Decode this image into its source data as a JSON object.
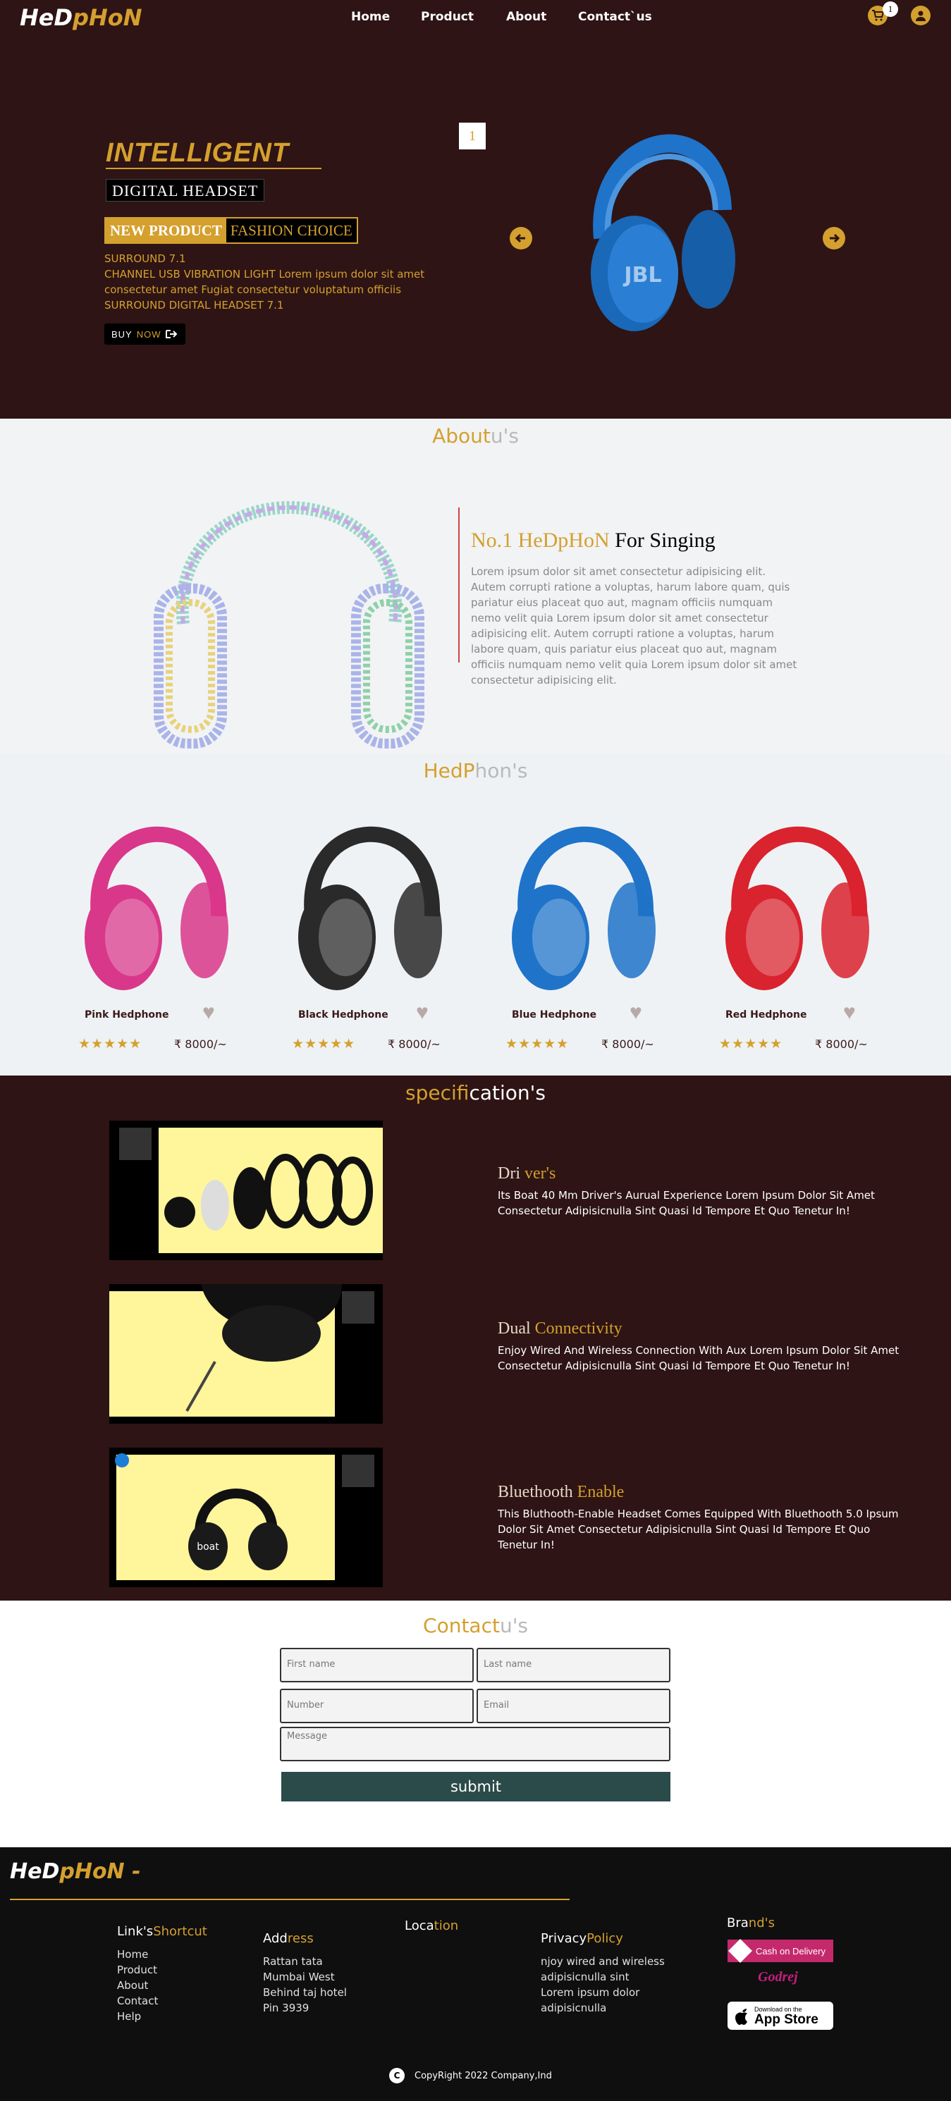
{
  "nav": {
    "logo_he": "HeD",
    "logo_ph": "pHoN",
    "links": [
      "Home",
      "Product",
      "About",
      "Contact`us"
    ],
    "cart_count": "1"
  },
  "hero": {
    "intelligent": "INTELLIGENT",
    "digital": "DIGITAL HEADSET",
    "tag_new": "NEW PRODUCT",
    "tag_fashion": "FASHION CHOICE",
    "desc": [
      "SURROUND 7.1",
      "CHANNEL USB VIBRATION LIGHT Lorem ipsum dolor sit amet consectetur amet Fugiat consectetur voluptatum officiis",
      "SURROUND DIGITAL HEADSET 7.1"
    ],
    "buy": "BUY",
    "now": "NOW",
    "slide_number": "1"
  },
  "about": {
    "title_a": "About",
    "title_b": "u's",
    "heading_a": "No.1 HeDpHoN",
    "heading_b": "For Singing",
    "text": "Lorem ipsum dolor sit amet consectetur adipisicing elit. Autem corrupti ratione a voluptas, harum labore quam, quis pariatur eius placeat quo aut, magnam officiis numquam nemo velit quia Lorem ipsum dolor sit amet consectetur adipisicing elit. Autem corrupti ratione a voluptas, harum labore quam, quis pariatur eius placeat quo aut, magnam officiis numquam nemo velit quia Lorem ipsum dolor sit amet consectetur adipisicing elit."
  },
  "products": {
    "title_a": "HedP",
    "title_b": "hon's",
    "items": [
      {
        "name": "Pink Hedphone",
        "price": "8000/~",
        "color": "#d9378a"
      },
      {
        "name": "Black Hedphone",
        "price": "8000/~",
        "color": "#2a2a2a"
      },
      {
        "name": "Blue Hedphone",
        "price": "8000/~",
        "color": "#1f73c9"
      },
      {
        "name": "Red Hedphone",
        "price": "8000/~",
        "color": "#d9232e"
      }
    ],
    "stars": "★★★★★",
    "rupee": "₹"
  },
  "spec": {
    "title_a": "specifi",
    "title_b": "cation's",
    "items": [
      {
        "title_a": "Dri",
        "title_b": "ver's",
        "text": "Its Boat 40 Mm Driver's Aurual Experience Lorem Ipsum Dolor Sit Amet Consectetur Adipisicnulla Sint Quasi Id Tempore Et Quo Tenetur In!"
      },
      {
        "title_a": "Dual",
        "title_b": "Connectivity",
        "text": "Enjoy Wired And Wireless Connection With Aux Lorem Ipsum Dolor Sit Amet Consectetur Adipisicnulla Sint Quasi Id Tempore Et Quo Tenetur In!"
      },
      {
        "title_a": "Bluethooth",
        "title_b": "Enable",
        "text": "This Bluthooth-Enable Headset Comes Equipped With Bluethooth 5.0 Ipsum Dolor Sit Amet Consectetur Adipisicnulla Sint Quasi Id Tempore Et Quo Tenetur In!"
      }
    ]
  },
  "contact": {
    "title_a": "Contact",
    "title_b": "u's",
    "first_name": "First name",
    "last_name": "Last name",
    "number": "Number",
    "email": "Email",
    "message": "Message",
    "submit": "submit"
  },
  "footer": {
    "logo_he": "HeD",
    "logo_ph": "pHoN",
    "logo_dash": "-",
    "links_title_a": "Link's",
    "links_title_b": "Shortcut",
    "links": [
      "Home",
      "Product",
      "About",
      "Contact",
      "Help"
    ],
    "address_title_a": "Add",
    "address_title_b": "ress",
    "address": [
      "Rattan tata",
      "Mumbai West",
      "Behind taj hotel",
      "Pin 3939"
    ],
    "location_a": "Loca",
    "location_b": "tion",
    "privacy_a": "Privacy",
    "privacy_b": "Policy",
    "privacy_text": [
      "njoy wired and wireless",
      "adipisicnulla sint",
      "Lorem ipsum dolor",
      "adipisicnulla"
    ],
    "brands_a": "Bra",
    "brands_b": "nd's",
    "cod": "Cash on Delivery",
    "godrej": "Godrej",
    "appstore_small": "Download on the",
    "appstore_big": "App Store",
    "copyright_icon": "C",
    "copyright": "CopyRight 2022 Company,Ind"
  }
}
